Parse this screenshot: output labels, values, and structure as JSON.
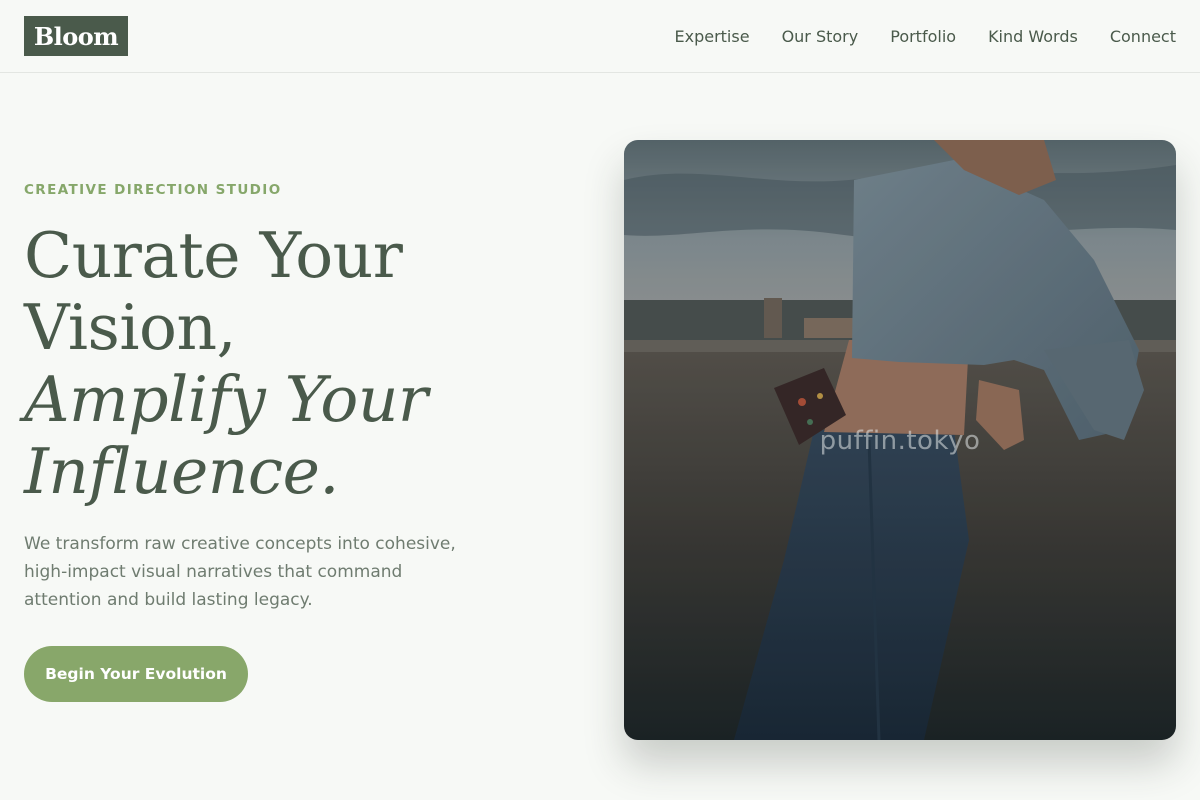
{
  "brand": {
    "logo_text": "Bloom"
  },
  "nav": {
    "items": [
      {
        "label": "Expertise"
      },
      {
        "label": "Our Story"
      },
      {
        "label": "Portfolio"
      },
      {
        "label": "Kind Words"
      },
      {
        "label": "Connect"
      }
    ]
  },
  "hero": {
    "eyebrow": "CREATIVE DIRECTION STUDIO",
    "headline_line1": "Curate Your",
    "headline_line2": "Vision,",
    "headline_line3": "Amplify Your",
    "headline_line4": "Influence.",
    "description": "We transform raw creative concepts into cohesive, high-impact visual narratives that command attention and build lasting legacy.",
    "cta_label": "Begin Your Evolution",
    "image_watermark": "puffin.tokyo"
  },
  "colors": {
    "background": "#f7f9f6",
    "primary_dark": "#4a5a4b",
    "accent_green": "#88a76a",
    "muted_text": "#6f7c70"
  }
}
